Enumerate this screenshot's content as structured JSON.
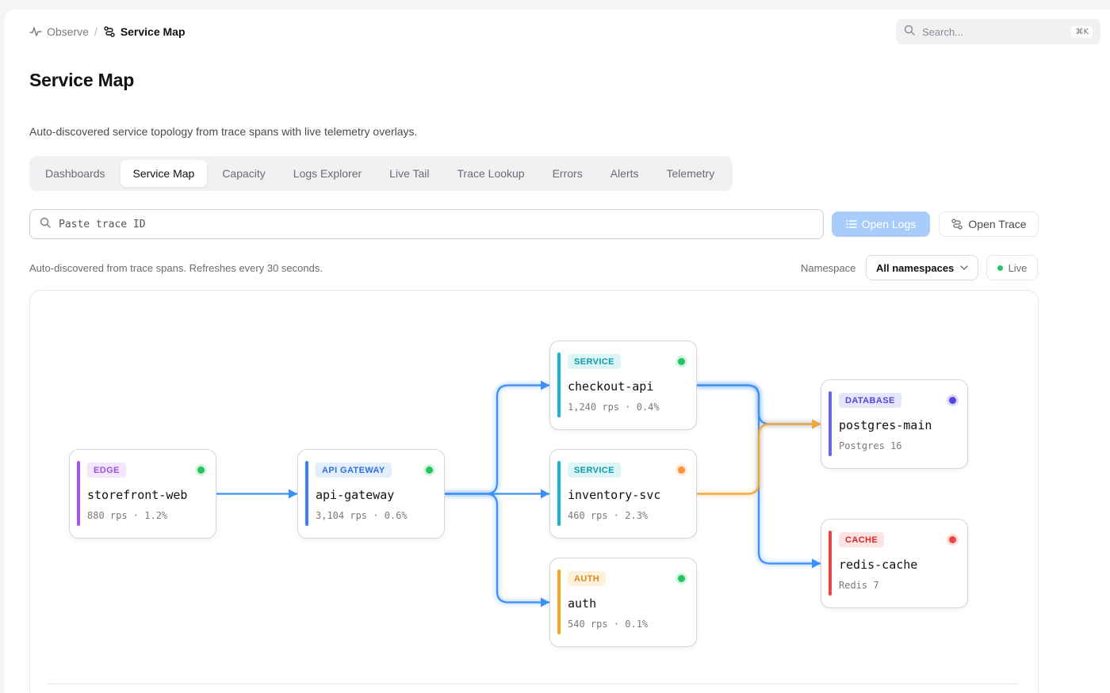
{
  "breadcrumb": {
    "parent": "Observe",
    "separator": "/",
    "current": "Service Map"
  },
  "search": {
    "placeholder": "Search...",
    "shortcut": "⌘K"
  },
  "page": {
    "title": "Service Map",
    "subtitle": "Auto-discovered service topology from trace spans with live telemetry overlays."
  },
  "tabs": [
    {
      "label": "Dashboards",
      "active": false
    },
    {
      "label": "Service Map",
      "active": true
    },
    {
      "label": "Capacity",
      "active": false
    },
    {
      "label": "Logs Explorer",
      "active": false
    },
    {
      "label": "Live Tail",
      "active": false
    },
    {
      "label": "Trace Lookup",
      "active": false
    },
    {
      "label": "Errors",
      "active": false
    },
    {
      "label": "Alerts",
      "active": false
    },
    {
      "label": "Telemetry",
      "active": false
    }
  ],
  "trace": {
    "placeholder": "Paste trace ID",
    "open_logs": "Open Logs",
    "open_trace": "Open Trace"
  },
  "toolbar": {
    "refresh_note": "Auto-discovered from trace spans. Refreshes every 30 seconds.",
    "namespace_label": "Namespace",
    "namespace_value": "All namespaces",
    "live_label": "Live"
  },
  "colors": {
    "edge_blue": "#3b8ff6",
    "edge_orange": "#f0a53a",
    "status_green": "#22c55e",
    "status_orange": "#fb923c",
    "status_red": "#ef4444",
    "status_indigo": "#4f46e5"
  },
  "nodes": [
    {
      "id": "storefront-web",
      "kind": "EDGE",
      "name": "storefront-web",
      "meta": "880 rps · 1.2%",
      "accent": "#a855f7",
      "badge_bg": "#f1e6fd",
      "badge_fg": "#9b51e0",
      "status": "#22c55e"
    },
    {
      "id": "api-gateway",
      "kind": "API GATEWAY",
      "name": "api-gateway",
      "meta": "3,104 rps · 0.6%",
      "accent": "#3b82f6",
      "badge_bg": "#e3efff",
      "badge_fg": "#2f6fe0",
      "status": "#22c55e"
    },
    {
      "id": "checkout-api",
      "kind": "SERVICE",
      "name": "checkout-api",
      "meta": "1,240 rps · 0.4%",
      "accent": "#14b8c8",
      "badge_bg": "#dcf6f8",
      "badge_fg": "#0e9aa8",
      "status": "#22c55e"
    },
    {
      "id": "inventory-svc",
      "kind": "SERVICE",
      "name": "inventory-svc",
      "meta": "460 rps · 2.3%",
      "accent": "#14b8c8",
      "badge_bg": "#dcf6f8",
      "badge_fg": "#0e9aa8",
      "status": "#fb923c"
    },
    {
      "id": "auth",
      "kind": "AUTH",
      "name": "auth",
      "meta": "540 rps · 0.1%",
      "accent": "#f5a524",
      "badge_bg": "#fdf1dc",
      "badge_fg": "#d9891a",
      "status": "#22c55e"
    },
    {
      "id": "postgres-main",
      "kind": "DATABASE",
      "name": "postgres-main",
      "meta": "Postgres 16",
      "accent": "#6366f1",
      "badge_bg": "#e6e6fb",
      "badge_fg": "#4f46e5",
      "status": "#4f46e5"
    },
    {
      "id": "redis-cache",
      "kind": "CACHE",
      "name": "redis-cache",
      "meta": "Redis 7",
      "accent": "#ef4444",
      "badge_bg": "#fde4e4",
      "badge_fg": "#dc2626",
      "status": "#ef4444"
    }
  ],
  "edges": [
    {
      "from": "storefront-web",
      "to": "api-gateway",
      "color": "blue"
    },
    {
      "from": "api-gateway",
      "to": "checkout-api",
      "color": "blue"
    },
    {
      "from": "api-gateway",
      "to": "inventory-svc",
      "color": "blue"
    },
    {
      "from": "api-gateway",
      "to": "auth",
      "color": "blue"
    },
    {
      "from": "checkout-api",
      "to": "postgres-main",
      "color": "blue"
    },
    {
      "from": "checkout-api",
      "to": "redis-cache",
      "color": "blue"
    },
    {
      "from": "inventory-svc",
      "to": "postgres-main",
      "color": "orange"
    }
  ]
}
